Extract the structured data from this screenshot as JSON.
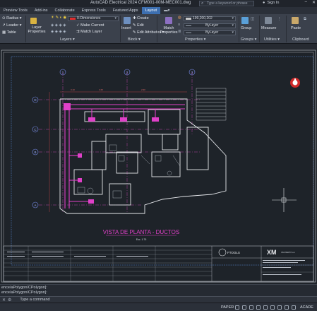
{
  "window": {
    "title": "AutoCAD Electrical 2024   CFM001-00M-MEC001.dwg",
    "search_placeholder": "Type a keyword or phrase",
    "signin": "Sign In"
  },
  "tabs": [
    {
      "label": "Preview Tools"
    },
    {
      "label": "Add-ins"
    },
    {
      "label": "Collaborate"
    },
    {
      "label": "Express Tools"
    },
    {
      "label": "Featured Apps"
    },
    {
      "label": "Layout",
      "active": true
    }
  ],
  "ribbon": {
    "annotation": {
      "radius": "Radius",
      "leader": "Leader",
      "table": "Table"
    },
    "layers": {
      "layer_properties": "Layer Properties",
      "current_layer": "0-Dimensiones",
      "make_current": "Make Current",
      "match_layer": "Match Layer",
      "panel": "Layers"
    },
    "block": {
      "insert": "Insert",
      "create": "Create",
      "edit": "Edit",
      "edit_attributes": "Edit Attributes",
      "panel": "Block"
    },
    "properties": {
      "match": "Match Properties",
      "color": "199,200,202",
      "linetype": "ByLayer",
      "lineweight": "ByLayer",
      "panel": "Properties"
    },
    "groups": {
      "group": "Group",
      "panel": "Groups"
    },
    "utilities": {
      "measure": "Measure",
      "panel": "Utilities"
    },
    "clipboard": {
      "paste": "Paste",
      "panel": "Clipboard"
    }
  },
  "drawing": {
    "plan_title": "VISTA DE PLANTA - DUCTOS",
    "scale": "Esc. 1:75",
    "grid_bubbles_top": [
      "1",
      "2",
      "3"
    ],
    "grid_bubbles_left": [
      "D",
      "C",
      "B",
      "A"
    ],
    "title_block_company": "XM",
    "title_block_brand": "FTOOLS",
    "title_block_sub": "XM PERÚ S.A."
  },
  "command": {
    "history": [
      "ence/aPolygon/CPolygon]:",
      "ence/aPolygon/CPolygon]:"
    ],
    "prompt": "Type a command"
  },
  "status": {
    "space": "PAPER",
    "right": "ACADE"
  },
  "colors": {
    "accent": "#3d6fb0",
    "magenta_duct": "#e040c8",
    "sheet_border": "#c8cdd6"
  }
}
